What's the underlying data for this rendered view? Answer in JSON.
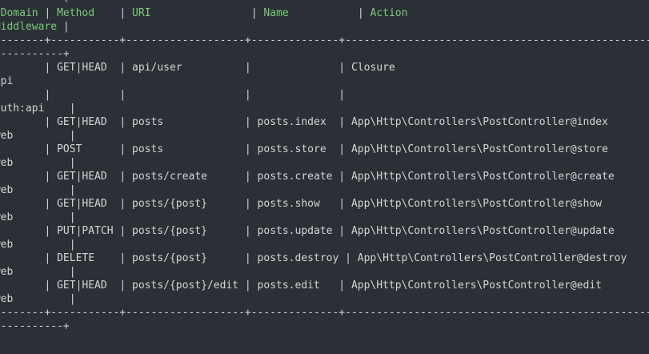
{
  "terminal": {
    "lines": [
      {
        "kind": "border",
        "text": "+-----------+"
      },
      {
        "kind": "header",
        "segments": [
          {
            "t": "| ",
            "c": "sep"
          },
          {
            "t": "Domain",
            "c": "hdr"
          },
          {
            "t": " | ",
            "c": "sep"
          },
          {
            "t": "Method   ",
            "c": "hdr"
          },
          {
            "t": " | ",
            "c": "sep"
          },
          {
            "t": "URI               ",
            "c": "hdr"
          },
          {
            "t": " | ",
            "c": "sep"
          },
          {
            "t": "Name          ",
            "c": "hdr"
          },
          {
            "t": " | ",
            "c": "sep"
          },
          {
            "t": "Action",
            "c": "hdr"
          }
        ]
      },
      {
        "kind": "header",
        "segments": [
          {
            "t": " ",
            "c": "sep"
          },
          {
            "t": "Middleware",
            "c": "hdr"
          },
          {
            "t": " |",
            "c": "sep"
          }
        ]
      },
      {
        "kind": "border",
        "text": "+--------+-----------+-------------------+--------------+--------------------------------------------------"
      },
      {
        "kind": "border",
        "text": "+-----------+"
      },
      {
        "kind": "row",
        "text": "|        | GET|HEAD  | api/user          |              | Closure"
      },
      {
        "kind": "row",
        "text": " api"
      },
      {
        "kind": "row",
        "text": "|        |           |                   |              |"
      },
      {
        "kind": "row",
        "text": " auth:api    |"
      },
      {
        "kind": "row",
        "text": "|        | GET|HEAD  | posts             | posts.index  | App\\Http\\Controllers\\PostController@index"
      },
      {
        "kind": "row",
        "text": " web         |"
      },
      {
        "kind": "row",
        "text": "|        | POST      | posts             | posts.store  | App\\Http\\Controllers\\PostController@store"
      },
      {
        "kind": "row",
        "text": " web         |"
      },
      {
        "kind": "row",
        "text": "|        | GET|HEAD  | posts/create      | posts.create | App\\Http\\Controllers\\PostController@create"
      },
      {
        "kind": "row",
        "text": " web         |"
      },
      {
        "kind": "row",
        "text": "|        | GET|HEAD  | posts/{post}      | posts.show   | App\\Http\\Controllers\\PostController@show"
      },
      {
        "kind": "row",
        "text": " web         |"
      },
      {
        "kind": "row",
        "text": "|        | PUT|PATCH | posts/{post}      | posts.update | App\\Http\\Controllers\\PostController@update"
      },
      {
        "kind": "row",
        "text": " web         |"
      },
      {
        "kind": "row",
        "text": "|        | DELETE    | posts/{post}      | posts.destroy | App\\Http\\Controllers\\PostController@destroy"
      },
      {
        "kind": "row",
        "text": " web         |"
      },
      {
        "kind": "row",
        "text": "|        | GET|HEAD  | posts/{post}/edit | posts.edit   | App\\Http\\Controllers\\PostController@edit"
      },
      {
        "kind": "row",
        "text": " web         |"
      },
      {
        "kind": "border",
        "text": "+--------+-----------+-------------------+--------------+--------------------------------------------------"
      },
      {
        "kind": "border",
        "text": "+-----------+"
      }
    ]
  },
  "colors": {
    "background": "#2b3036",
    "text": "#d4d4d4",
    "header": "#7ec87e"
  }
}
